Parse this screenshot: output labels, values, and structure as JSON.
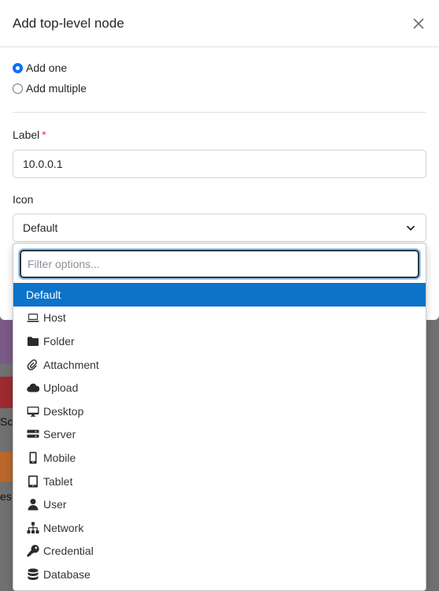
{
  "modal": {
    "title": "Add top-level node",
    "radios": [
      {
        "label": "Add one",
        "checked": true
      },
      {
        "label": "Add multiple",
        "checked": false
      }
    ],
    "label_field": {
      "label": "Label",
      "required_mark": "*",
      "value": "10.0.0.1"
    },
    "icon_field": {
      "label": "Icon",
      "selected": "Default"
    }
  },
  "dropdown": {
    "filter_placeholder": "Filter options...",
    "options": [
      {
        "label": "Default",
        "icon": null,
        "selected": true
      },
      {
        "label": "Host",
        "icon": "laptop-icon"
      },
      {
        "label": "Folder",
        "icon": "folder-icon"
      },
      {
        "label": "Attachment",
        "icon": "paperclip-icon"
      },
      {
        "label": "Upload",
        "icon": "cloud-icon"
      },
      {
        "label": "Desktop",
        "icon": "desktop-icon"
      },
      {
        "label": "Server",
        "icon": "server-icon"
      },
      {
        "label": "Mobile",
        "icon": "mobile-icon"
      },
      {
        "label": "Tablet",
        "icon": "tablet-icon"
      },
      {
        "label": "User",
        "icon": "user-icon"
      },
      {
        "label": "Network",
        "icon": "network-icon"
      },
      {
        "label": "Credential",
        "icon": "key-icon"
      },
      {
        "label": "Database",
        "icon": "database-icon"
      }
    ]
  },
  "background": {
    "fragments": [
      "Sc",
      "es"
    ]
  },
  "colors": {
    "selected_option_bg": "#0c73c9",
    "required": "#dc3545",
    "radio_checked": "#0d6efd"
  }
}
